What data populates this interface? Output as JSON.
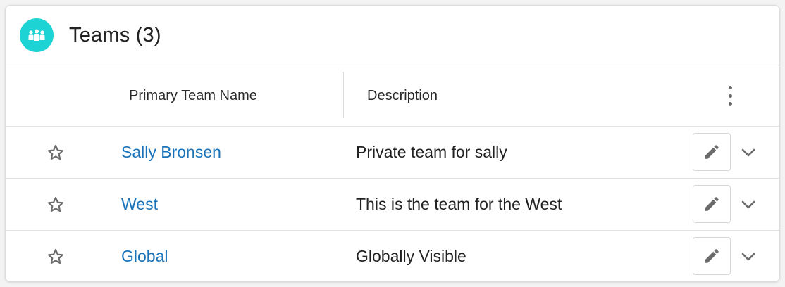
{
  "card": {
    "title": "Teams (3)",
    "icon": "team-group-icon",
    "icon_color": "#1ed3d3"
  },
  "columns": {
    "name": "Primary Team Name",
    "description": "Description"
  },
  "colors": {
    "link": "#1a73b8",
    "icon_gray": "#6b6b6b"
  },
  "rows": [
    {
      "name": "Sally Bronsen",
      "description": "Private team for sally",
      "starred": false
    },
    {
      "name": "West",
      "description": "This is the team for the West",
      "starred": false
    },
    {
      "name": "Global",
      "description": "Globally Visible",
      "starred": false
    }
  ]
}
